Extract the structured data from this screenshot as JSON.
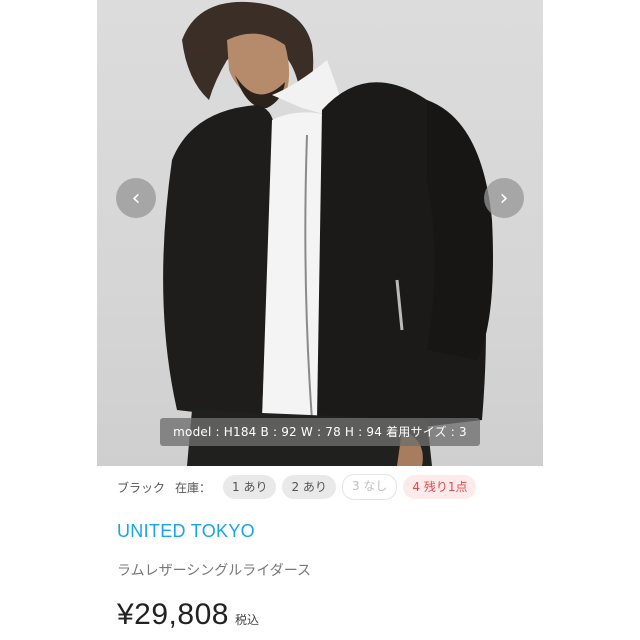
{
  "product": {
    "photo": {
      "alt": "",
      "caption": "model : H184 B : 92 W : 78 H : 94 着用サイズ : 3",
      "prev_icon": "‹",
      "next_icon": "›"
    },
    "stock": {
      "color_label": "ブラック",
      "stock_label": "在庫：",
      "sizes": [
        {
          "label": "1 あり",
          "state": "available"
        },
        {
          "label": "2 あり",
          "state": "available"
        },
        {
          "label": "3 なし",
          "state": "soldout"
        },
        {
          "label": "4 残り1点",
          "state": "low"
        }
      ]
    },
    "brand": "UNITED TOKYO",
    "name": "ラムレザーシングルライダース",
    "price": "¥29,808",
    "tax_label": "税込"
  },
  "colors": {
    "brand_blue": "#1aa3e8",
    "alert_red": "#e44b4b",
    "chip_gray": "#e9e9e9"
  }
}
